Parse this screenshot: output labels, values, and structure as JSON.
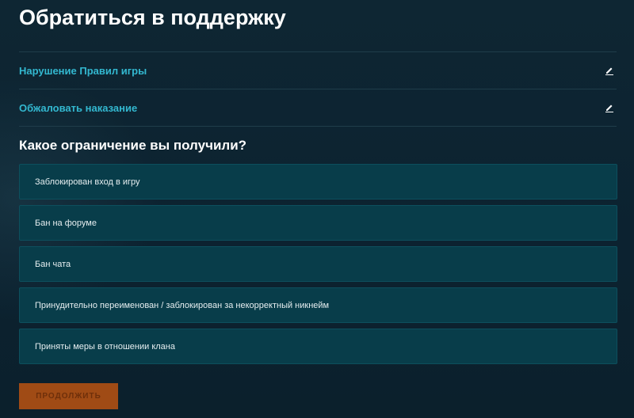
{
  "page": {
    "title": "Обратиться в поддержку"
  },
  "breadcrumbs": [
    {
      "label": "Нарушение Правил игры",
      "icon": "pencil-icon"
    },
    {
      "label": "Обжаловать наказание",
      "icon": "pencil-icon"
    }
  ],
  "question": "Какое ограничение вы получили?",
  "options": [
    {
      "label": "Заблокирован вход в игру"
    },
    {
      "label": "Бан на форуме"
    },
    {
      "label": "Бан чата"
    },
    {
      "label": "Принудительно переименован / заблокирован за некорректный никнейм"
    },
    {
      "label": "Приняты меры в отношении клана"
    }
  ],
  "actions": {
    "continue_label": "ПРОДОЛЖИТЬ"
  },
  "colors": {
    "background": "#0d2430",
    "accent": "#33b8d0",
    "option_background": "#083d4a",
    "button_background": "#a04b15"
  }
}
